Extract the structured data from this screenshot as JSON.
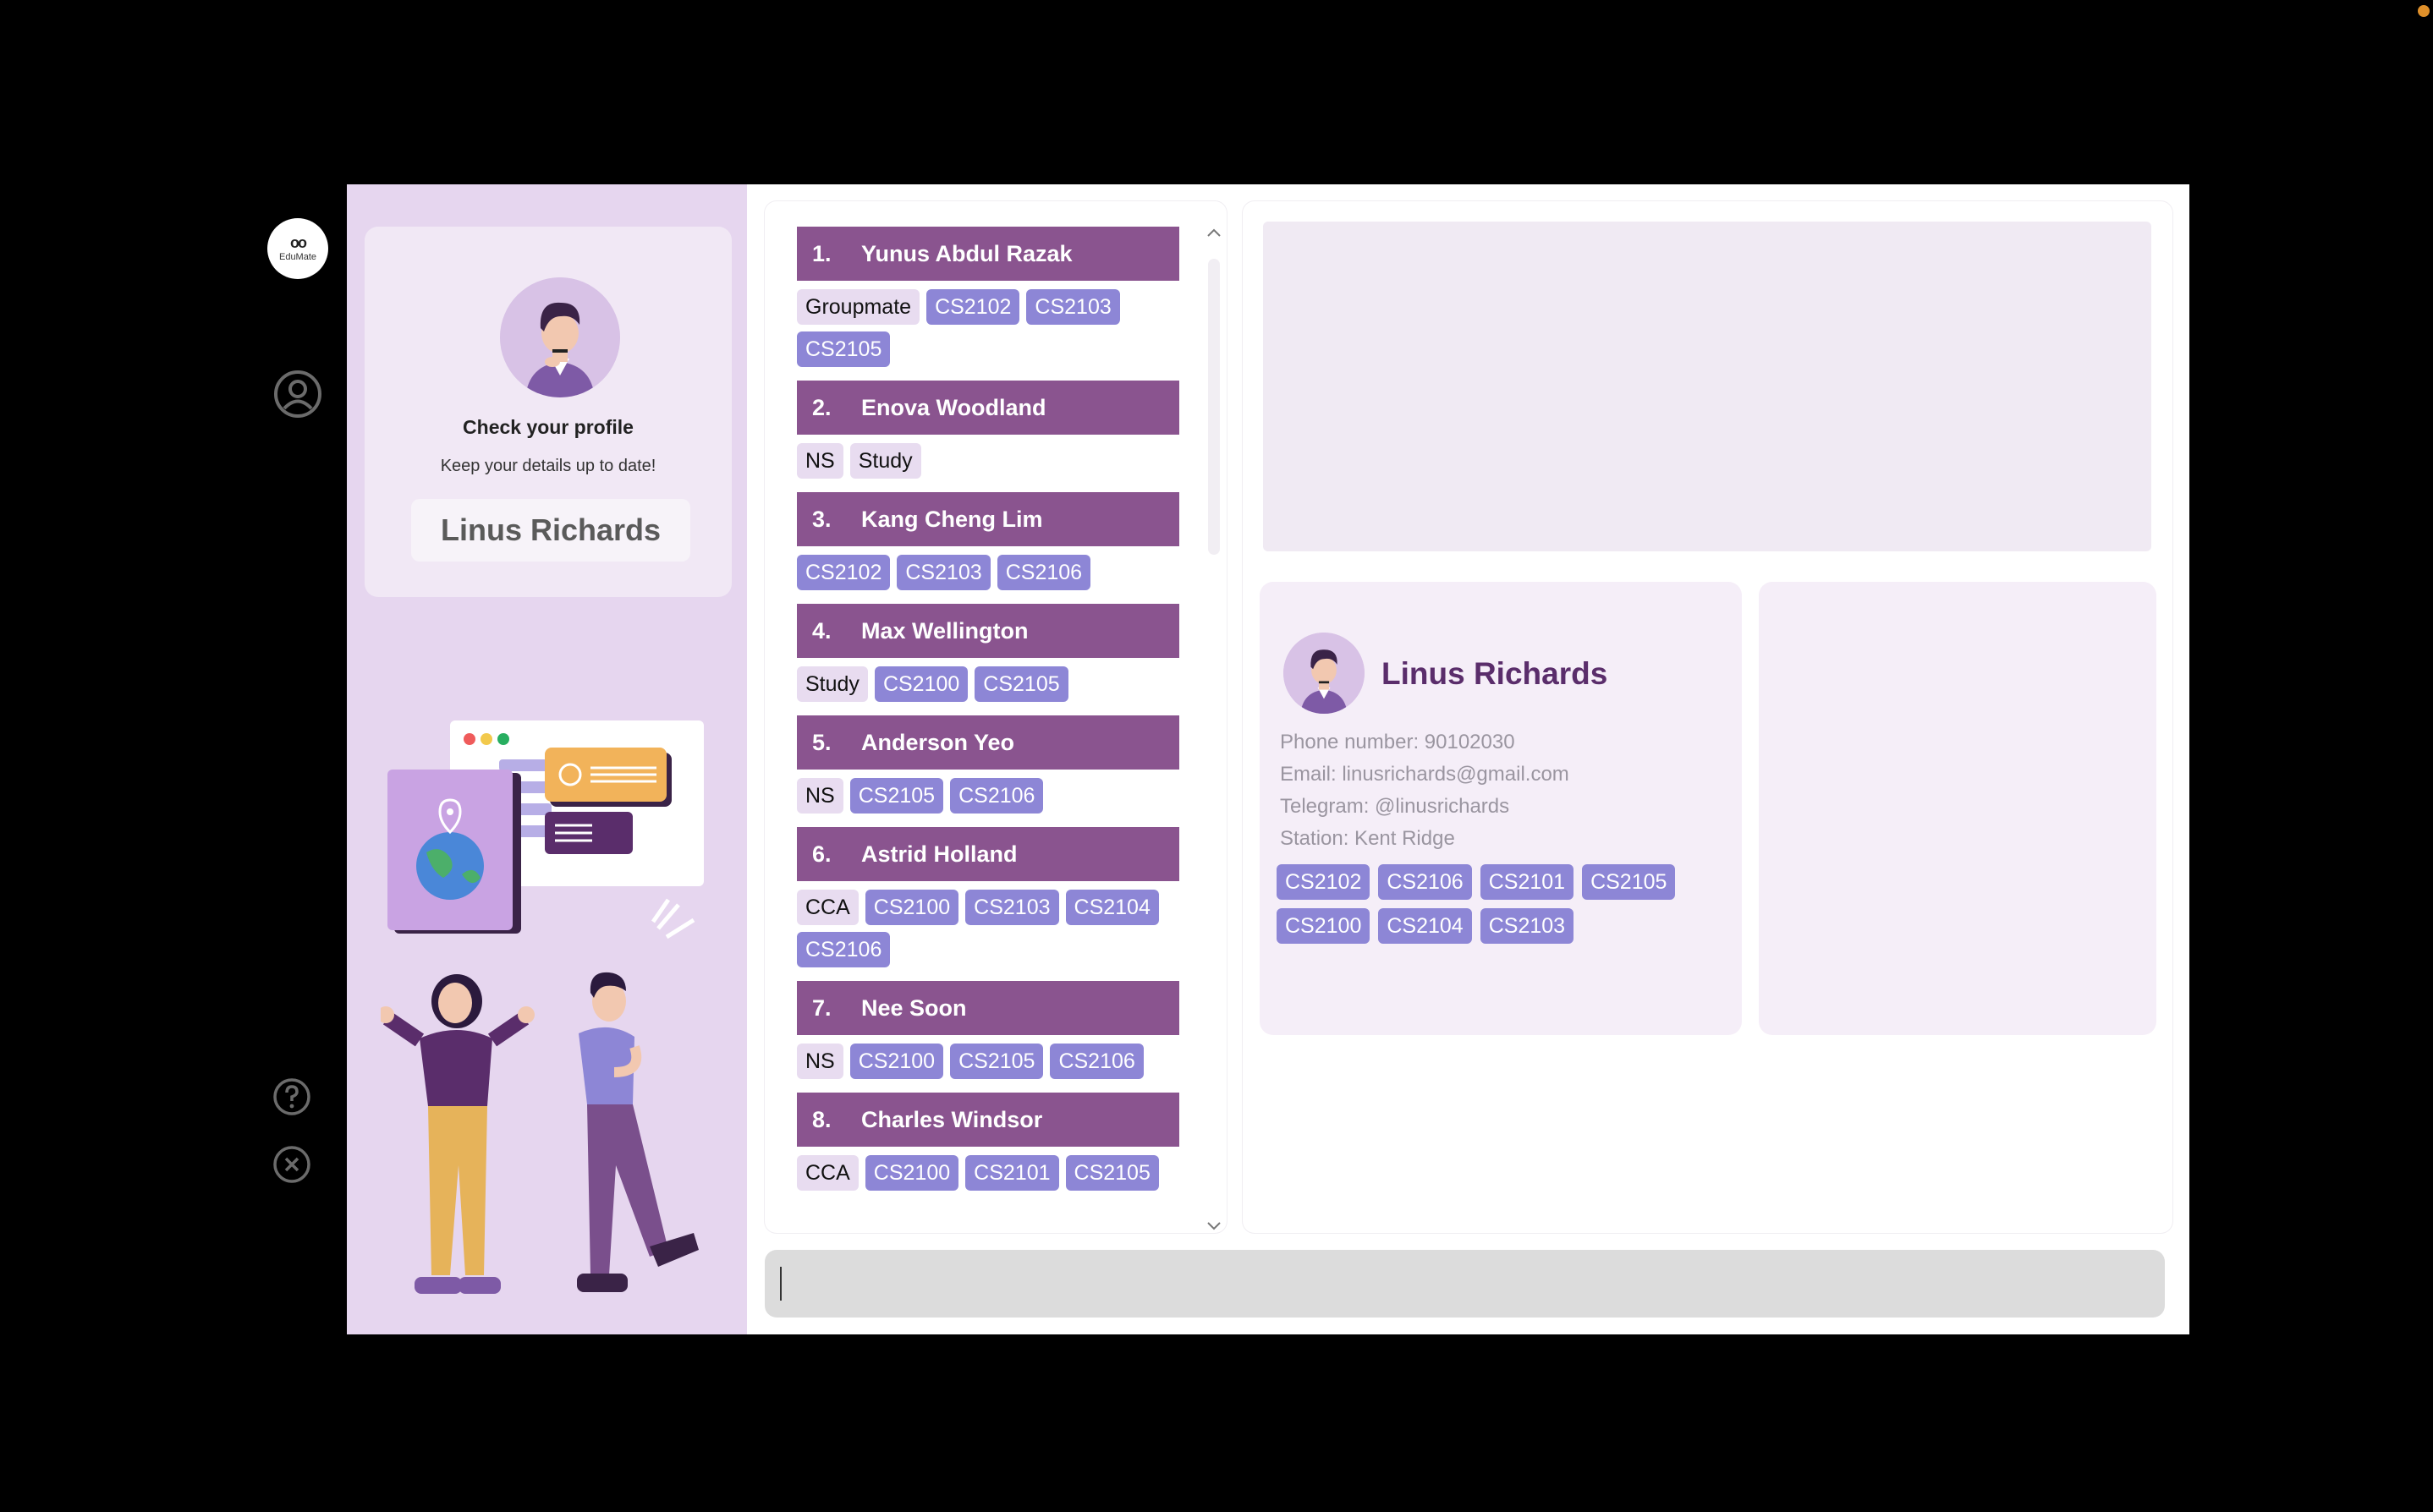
{
  "app": {
    "logo_text": "EduMate",
    "logo_glyph": "oo",
    "accent": "#8a548f",
    "tag_color": "#8d86d6",
    "group_tag_color": "#e8dcf0"
  },
  "sidebar": {
    "profile_icon": "user-circle-icon",
    "help_icon": "question-circle-icon",
    "exit_icon": "close-circle-icon"
  },
  "profile_card": {
    "title": "Check your profile",
    "subtitle": "Keep your details up to date!",
    "name": "Linus Richards"
  },
  "contacts": [
    {
      "index": "1.",
      "name": "Yunus Abdul Razak",
      "groups": [
        "Groupmate"
      ],
      "modules": [
        "CS2102",
        "CS2103",
        "CS2105"
      ]
    },
    {
      "index": "2.",
      "name": "Enova Woodland",
      "groups": [
        "NS",
        "Study"
      ],
      "modules": []
    },
    {
      "index": "3.",
      "name": "Kang Cheng Lim",
      "groups": [],
      "modules": [
        "CS2102",
        "CS2103",
        "CS2106"
      ]
    },
    {
      "index": "4.",
      "name": "Max Wellington",
      "groups": [
        "Study"
      ],
      "modules": [
        "CS2100",
        "CS2105"
      ]
    },
    {
      "index": "5.",
      "name": "Anderson Yeo",
      "groups": [
        "NS"
      ],
      "modules": [
        "CS2105",
        "CS2106"
      ]
    },
    {
      "index": "6.",
      "name": "Astrid Holland",
      "groups": [
        "CCA"
      ],
      "modules": [
        "CS2100",
        "CS2103",
        "CS2104",
        "CS2106"
      ]
    },
    {
      "index": "7.",
      "name": "Nee Soon",
      "groups": [
        "NS"
      ],
      "modules": [
        "CS2100",
        "CS2105",
        "CS2106"
      ]
    },
    {
      "index": "8.",
      "name": "Charles Windsor",
      "groups": [
        "CCA"
      ],
      "modules": [
        "CS2100",
        "CS2101",
        "CS2105"
      ]
    }
  ],
  "detail": {
    "name": "Linus Richards",
    "phone": "Phone number: 90102030",
    "email": "Email: linusrichards@gmail.com",
    "telegram": "Telegram: @linusrichards",
    "station": "Station: Kent Ridge",
    "modules": [
      "CS2102",
      "CS2106",
      "CS2101",
      "CS2105",
      "CS2100",
      "CS2104",
      "CS2103"
    ]
  },
  "command_box": {
    "value": ""
  }
}
